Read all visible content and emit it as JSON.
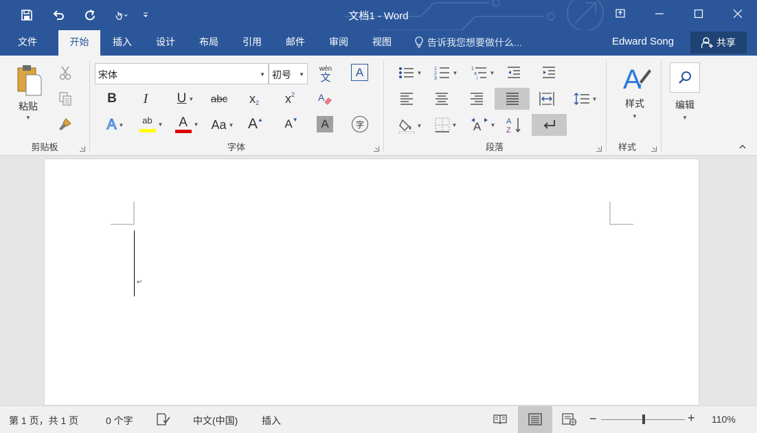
{
  "window": {
    "title": "文档1 - Word"
  },
  "quick_access": {
    "save_icon": "save-icon",
    "undo_icon": "undo-icon",
    "redo_icon": "redo-icon",
    "touch_icon": "touch-mode-icon",
    "customize_icon": "customize-qat-icon"
  },
  "tabs": [
    {
      "label": "文件",
      "active": false
    },
    {
      "label": "开始",
      "active": true
    },
    {
      "label": "插入",
      "active": false
    },
    {
      "label": "设计",
      "active": false
    },
    {
      "label": "布局",
      "active": false
    },
    {
      "label": "引用",
      "active": false
    },
    {
      "label": "邮件",
      "active": false
    },
    {
      "label": "审阅",
      "active": false
    },
    {
      "label": "视图",
      "active": false
    }
  ],
  "tell_me": {
    "placeholder": "告诉我您想要做什么..."
  },
  "account": {
    "user_name": "Edward Song",
    "share_label": "共享"
  },
  "ribbon": {
    "clipboard": {
      "label": "剪贴板",
      "paste_label": "粘贴"
    },
    "font": {
      "label": "字体",
      "font_name": "宋体",
      "font_size": "初号",
      "phonetic_top": "wén",
      "phonetic_bottom": "文",
      "border_char": "A",
      "bold": "B",
      "italic": "I",
      "underline": "U",
      "strikethrough": "abc",
      "subscript": "x",
      "subscript_mark": "2",
      "superscript": "x",
      "superscript_mark": "2",
      "text_effect": "A",
      "highlight_text": "ab",
      "font_color_char": "A",
      "change_case": "Aa",
      "grow_font": "A",
      "shrink_font": "A",
      "char_shading": "A",
      "enclose_char": "字",
      "highlight_color": "#ffff00",
      "font_color": "#e00000"
    },
    "paragraph": {
      "label": "段落"
    },
    "styles": {
      "label": "样式",
      "styles_button": "样式"
    },
    "editing": {
      "editing_button": "编辑"
    }
  },
  "statusbar": {
    "page_info": "第 1 页，共 1 页",
    "word_count": "0 个字",
    "language": "中文(中国)",
    "mode": "插入",
    "zoom": "110%",
    "zoom_minus": "−",
    "zoom_plus": "+"
  },
  "colors": {
    "brand": "#2b579a",
    "ribbon_bg": "#f3f3f3",
    "share_bg": "#1e4374"
  }
}
